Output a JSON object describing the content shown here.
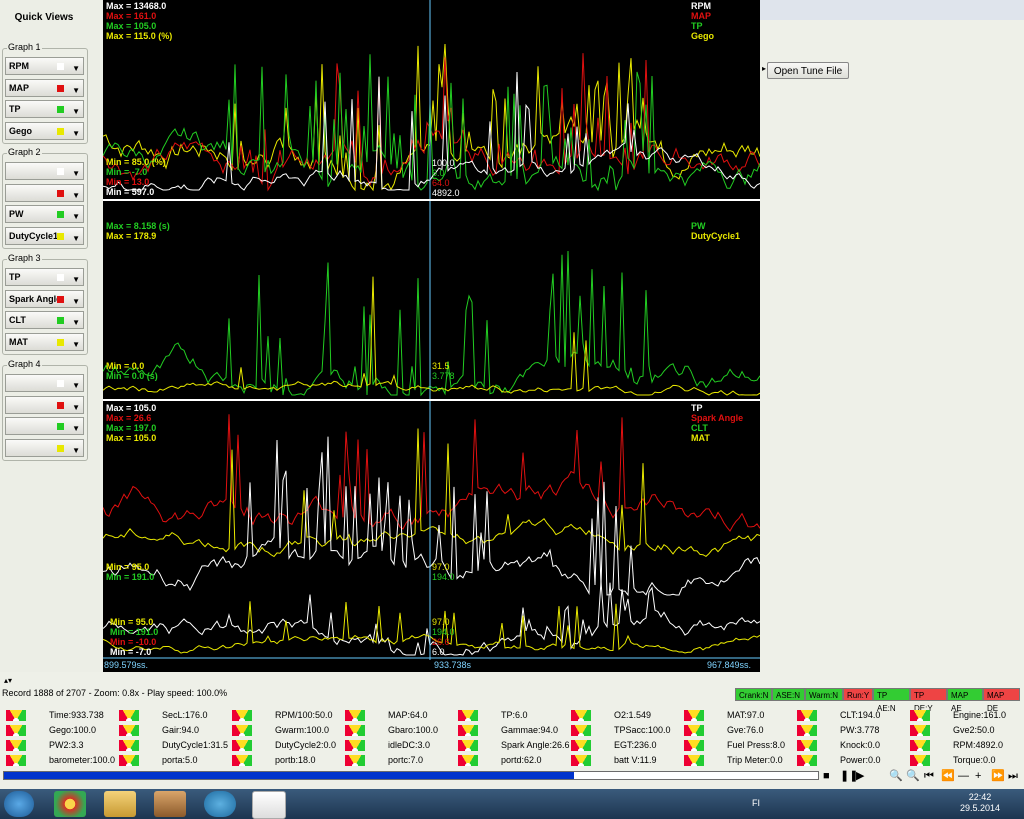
{
  "quick_views": {
    "title": "Quick Views",
    "groups": [
      {
        "title": "Graph 1",
        "items": [
          {
            "label": "RPM",
            "color": "#ffffff"
          },
          {
            "label": "MAP",
            "color": "#e01010"
          },
          {
            "label": "TP",
            "color": "#22cc22"
          },
          {
            "label": "Gego",
            "color": "#e8e800"
          }
        ]
      },
      {
        "title": "Graph 2",
        "items": [
          {
            "label": "",
            "color": "#ffffff"
          },
          {
            "label": "",
            "color": "#e01010"
          },
          {
            "label": "PW",
            "color": "#22cc22"
          },
          {
            "label": "DutyCycle1",
            "color": "#e8e800"
          }
        ]
      },
      {
        "title": "Graph 3",
        "items": [
          {
            "label": "TP",
            "color": "#ffffff"
          },
          {
            "label": "Spark Angle",
            "color": "#e01010"
          },
          {
            "label": "CLT",
            "color": "#22cc22"
          },
          {
            "label": "MAT",
            "color": "#e8e800"
          }
        ]
      },
      {
        "title": "Graph 4",
        "items": [
          {
            "label": "",
            "color": "#ffffff"
          },
          {
            "label": "",
            "color": "#e01010"
          },
          {
            "label": "",
            "color": "#22cc22"
          },
          {
            "label": "",
            "color": "#e8e800"
          }
        ]
      }
    ]
  },
  "graphs": {
    "g1": {
      "max_labels": [
        {
          "text": "Max = 13468.0",
          "color": "#ffffff"
        },
        {
          "text": "Max = 161.0",
          "color": "#e01010"
        },
        {
          "text": "Max = 105.0",
          "color": "#22cc22"
        },
        {
          "text": "Max = 115.0 (%)",
          "color": "#e8e800"
        }
      ],
      "min_labels": [
        {
          "text": "Min = 85.0 (%)",
          "color": "#e8e800"
        },
        {
          "text": "Min = -7.0",
          "color": "#22cc22"
        },
        {
          "text": "Min = 13.0",
          "color": "#e01010"
        },
        {
          "text": "Min = 597.0",
          "color": "#ffffff"
        }
      ],
      "legend": [
        {
          "text": "RPM",
          "color": "#ffffff"
        },
        {
          "text": "MAP",
          "color": "#e01010"
        },
        {
          "text": "TP",
          "color": "#22cc22"
        },
        {
          "text": "Gego",
          "color": "#e8e800"
        }
      ],
      "cursor_values": [
        {
          "text": "100.0",
          "color": "#ffffff"
        },
        {
          "text": "6.0",
          "color": "#22cc22"
        },
        {
          "text": "64.0",
          "color": "#e01010"
        },
        {
          "text": "4892.0",
          "color": "#ffffff"
        }
      ]
    },
    "g2": {
      "max_labels": [
        {
          "text": "Max = 8.158 (s)",
          "color": "#22cc22"
        },
        {
          "text": "Max = 178.9",
          "color": "#e8e800"
        }
      ],
      "min_labels": [
        {
          "text": "Min = 0.0",
          "color": "#e8e800"
        },
        {
          "text": "Min = 0.0 (s)",
          "color": "#22cc22"
        }
      ],
      "legend": [
        {
          "text": "PW",
          "color": "#22cc22"
        },
        {
          "text": "DutyCycle1",
          "color": "#e8e800"
        }
      ],
      "cursor_values": [
        {
          "text": "31.5",
          "color": "#e8e800"
        },
        {
          "text": "3.778",
          "color": "#22cc22"
        }
      ]
    },
    "g3": {
      "max_labels": [
        {
          "text": "Max = 105.0",
          "color": "#ffffff"
        },
        {
          "text": "Max = 26.6",
          "color": "#e01010"
        },
        {
          "text": "Max = 197.0",
          "color": "#22cc22"
        },
        {
          "text": "Max = 105.0",
          "color": "#e8e800"
        }
      ],
      "min_labels": [
        {
          "text": "Min = 95.0",
          "color": "#e8e800"
        },
        {
          "text": "Min = 191.0",
          "color": "#22cc22"
        }
      ],
      "legend": [
        {
          "text": "TP",
          "color": "#ffffff"
        },
        {
          "text": "Spark Angle",
          "color": "#e01010"
        },
        {
          "text": "CLT",
          "color": "#22cc22"
        },
        {
          "text": "MAT",
          "color": "#e8e800"
        }
      ],
      "cursor_values": [
        {
          "text": "97.0",
          "color": "#e8e800"
        },
        {
          "text": "194.0",
          "color": "#22cc22"
        }
      ]
    },
    "g4": {
      "min_labels": [
        {
          "text": "Min = 95.0",
          "color": "#e8e800"
        },
        {
          "text": "Min = 191.0",
          "color": "#22cc22"
        },
        {
          "text": "Min = -10.0",
          "color": "#e01010"
        },
        {
          "text": "Min = -7.0",
          "color": "#ffffff"
        }
      ],
      "cursor_values": [
        {
          "text": "97.0",
          "color": "#e8e800"
        },
        {
          "text": "194.0",
          "color": "#22cc22"
        },
        {
          "text": "26.6",
          "color": "#e01010"
        },
        {
          "text": "6.0",
          "color": "#ffffff"
        }
      ]
    },
    "time_axis": {
      "left": "899.579ss.",
      "center": "933.738s",
      "right": "967.849ss."
    }
  },
  "open_tune_file": "Open Tune File",
  "status": {
    "record_line": "Record 1888 of 2707 - Zoom: 0.8x - Play speed: 100.0%",
    "flags": [
      {
        "text": "Crank:N",
        "color": "#33cc33"
      },
      {
        "text": "ASE:N",
        "color": "#33cc33"
      },
      {
        "text": "Warm:N",
        "color": "#33cc33"
      },
      {
        "text": "Run:Y",
        "color": "#ee4444"
      },
      {
        "text": "TP AE:N",
        "color": "#33cc33"
      },
      {
        "text": "TP DE:Y",
        "color": "#ee4444"
      },
      {
        "text": "MAP AE",
        "color": "#33cc33"
      },
      {
        "text": "MAP DE",
        "color": "#ee4444"
      }
    ],
    "progress": 0.7
  },
  "gauges": [
    [
      "Time:933.738",
      "SecL:176.0",
      "RPM/100:50.0",
      "MAP:64.0",
      "TP:6.0",
      "O2:1.549",
      "MAT:97.0",
      "CLT:194.0",
      "Engine:161.0"
    ],
    [
      "Gego:100.0",
      "Gair:94.0",
      "Gwarm:100.0",
      "Gbaro:100.0",
      "Gammae:94.0",
      "TPSacc:100.0",
      "Gve:76.0",
      "PW:3.778",
      "Gve2:50.0"
    ],
    [
      "PW2:3.3",
      "DutyCycle1:31.5",
      "DutyCycle2:0.0",
      "idleDC:3.0",
      "Spark Angle:26.6",
      "EGT:236.0",
      "Fuel Press:8.0",
      "Knock:0.0",
      "RPM:4892.0"
    ],
    [
      "barometer:100.0",
      "porta:5.0",
      "portb:18.0",
      "portc:7.0",
      "portd:62.0",
      "batt V:11.9",
      "Trip Meter:0.0",
      "Power:0.0",
      "Torque:0.0"
    ]
  ],
  "taskbar": {
    "lang": "FI",
    "time": "22:42",
    "date": "29.5.2014"
  },
  "colors": {
    "rpm": "#ffffff",
    "map": "#e01010",
    "tp": "#22cc22",
    "gego": "#e8e800",
    "cursor": "#66ccff"
  }
}
